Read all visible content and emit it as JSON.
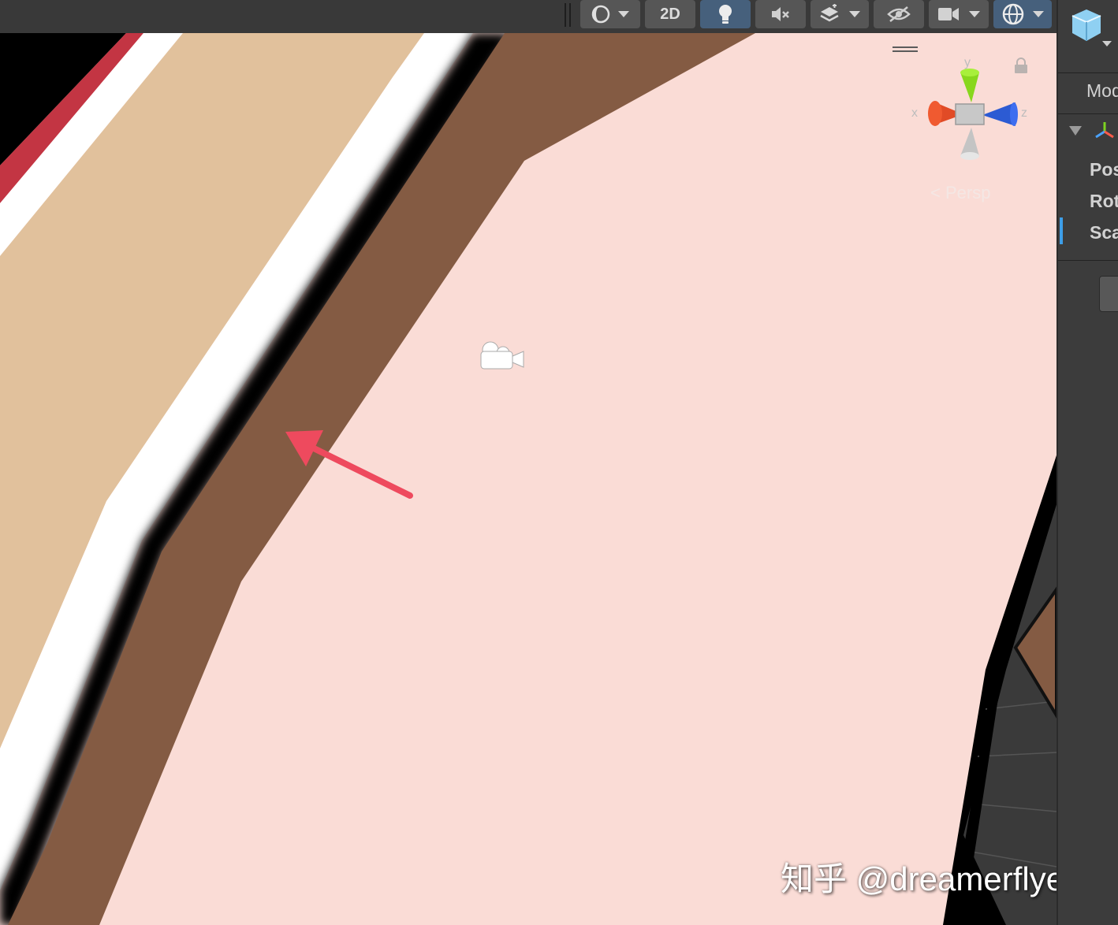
{
  "toolbar": {
    "shading_icon": "sphere-icon",
    "mode_2d_label": "2D",
    "lighting_icon": "lightbulb-icon",
    "audio_icon": "audio-mute-icon",
    "effects_icon": "layers-icon",
    "visibility_icon": "eye-hidden-icon",
    "camera_icon": "video-camera-icon",
    "gizmos_icon": "gizmo-globe-icon"
  },
  "scene": {
    "view_mode_label": "Persp",
    "axis_labels": {
      "x": "x",
      "y": "y",
      "z": "z"
    },
    "colors": {
      "background": "#fadcd6",
      "brown_band": "#845b43",
      "tan_band": "#e1c19c",
      "red_stripe": "#c33543",
      "arrow": "#ee4a5e"
    },
    "watermark": "知乎 @dreamerflyer"
  },
  "inspector": {
    "mode_label": "Mod",
    "transform_rows": [
      "Pos",
      "Rot",
      "Sca"
    ]
  }
}
